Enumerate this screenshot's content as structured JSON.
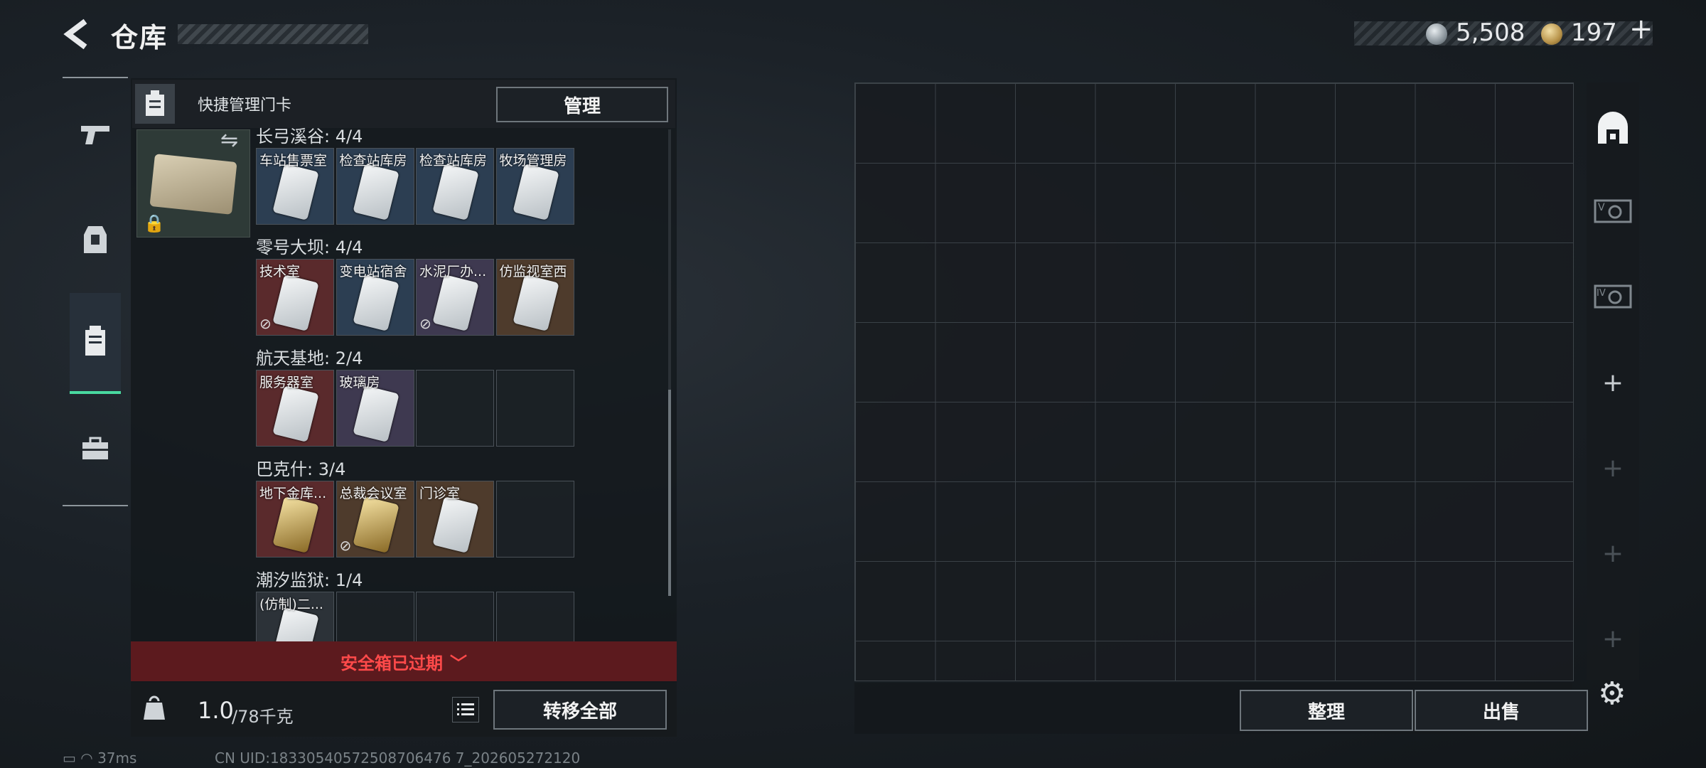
{
  "header": {
    "title": "仓库",
    "currency_silver": "5,508",
    "currency_gold": "197",
    "currency_gold_plus": "+"
  },
  "quick_panel": {
    "label": "快捷管理门卡",
    "manage_button": "管理"
  },
  "groups": [
    {
      "name": "长弓溪谷: 4/4",
      "cells": [
        {
          "name": "车站售票室",
          "style": "blue",
          "unusable": false
        },
        {
          "name": "检查站库房",
          "style": "blue",
          "unusable": false
        },
        {
          "name": "检查站库房",
          "style": "blue",
          "unusable": false
        },
        {
          "name": "牧场管理房",
          "style": "blue",
          "unusable": false
        }
      ]
    },
    {
      "name": "零号大坝: 4/4",
      "cells": [
        {
          "name": "技术室",
          "style": "red",
          "unusable": true
        },
        {
          "name": "变电站宿舍",
          "style": "blue",
          "unusable": false
        },
        {
          "name": "水泥厂办...",
          "style": "purple",
          "unusable": true
        },
        {
          "name": "仿监视室西",
          "style": "brown",
          "unusable": false
        }
      ]
    },
    {
      "name": "航天基地: 2/4",
      "cells": [
        {
          "name": "服务器室",
          "style": "red",
          "unusable": false
        },
        {
          "name": "玻璃房",
          "style": "purple",
          "unusable": false
        },
        {
          "name": "",
          "style": "empty",
          "unusable": false
        },
        {
          "name": "",
          "style": "empty",
          "unusable": false
        }
      ]
    },
    {
      "name": "巴克什: 3/4",
      "cells": [
        {
          "name": "地下金库...",
          "style": "red-gold",
          "unusable": false
        },
        {
          "name": "总裁会议室",
          "style": "brown-gold",
          "unusable": true
        },
        {
          "name": "门诊室",
          "style": "brown",
          "unusable": false
        },
        {
          "name": "",
          "style": "empty",
          "unusable": false
        }
      ]
    },
    {
      "name": "潮汐监狱: 1/4",
      "cells": [
        {
          "name": "(仿制)二...",
          "style": "dark",
          "unusable": false
        },
        {
          "name": "",
          "style": "empty",
          "unusable": false
        },
        {
          "name": "",
          "style": "empty",
          "unusable": false
        },
        {
          "name": "",
          "style": "empty",
          "unusable": false
        }
      ]
    }
  ],
  "safebox": {
    "expired_text": "安全箱已过期",
    "weight_value": "1.0",
    "weight_capacity": "/78千克",
    "kg_icon": "kg-weight-icon",
    "transfer_all": "转移全部"
  },
  "stash": {
    "arrange_button": "整理",
    "sell_button": "出售"
  },
  "footer": {
    "ping": "37ms",
    "uid": "CN UID:18330540572508706476 7_202605272120"
  },
  "colors": {
    "active_tab": "#49d9a0",
    "expired": "#ff4a4a"
  }
}
